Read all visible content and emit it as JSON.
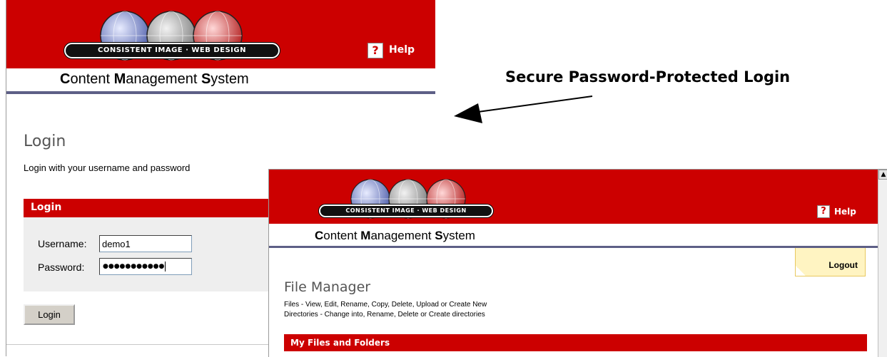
{
  "logo": {
    "text": "CONSISTENT IMAGE · WEB DESIGN"
  },
  "header": {
    "help_label": "Help",
    "help_icon": "?",
    "cms_title_parts": {
      "c": "C",
      "c_rest": "ontent ",
      "m": "M",
      "m_rest": "anagement ",
      "s": "S",
      "s_rest": "ystem"
    }
  },
  "annotation": {
    "text": "Secure Password-Protected Login"
  },
  "login_page": {
    "heading": "Login",
    "subtitle": "Login with your username and password",
    "panel_title": "Login",
    "username_label": "Username:",
    "username_value": "demo1",
    "password_label": "Password:",
    "password_value": "●●●●●●●●●●●",
    "submit_label": "Login"
  },
  "file_manager": {
    "logout_label": "Logout",
    "heading": "File Manager",
    "description_line1": "Files - View, Edit, Rename, Copy, Delete, Upload or Create New",
    "description_line2": "Directories - Change into, Rename, Delete or Create directories",
    "section_title": "My Files and Folders"
  },
  "colors": {
    "brand_red": "#cc0000",
    "rule_blue": "#5d5f86",
    "logout_tab": "#fff4c2"
  },
  "icons": {
    "help": "help-icon",
    "globe": "globe-icon",
    "arrow": "arrow-left-icon"
  }
}
